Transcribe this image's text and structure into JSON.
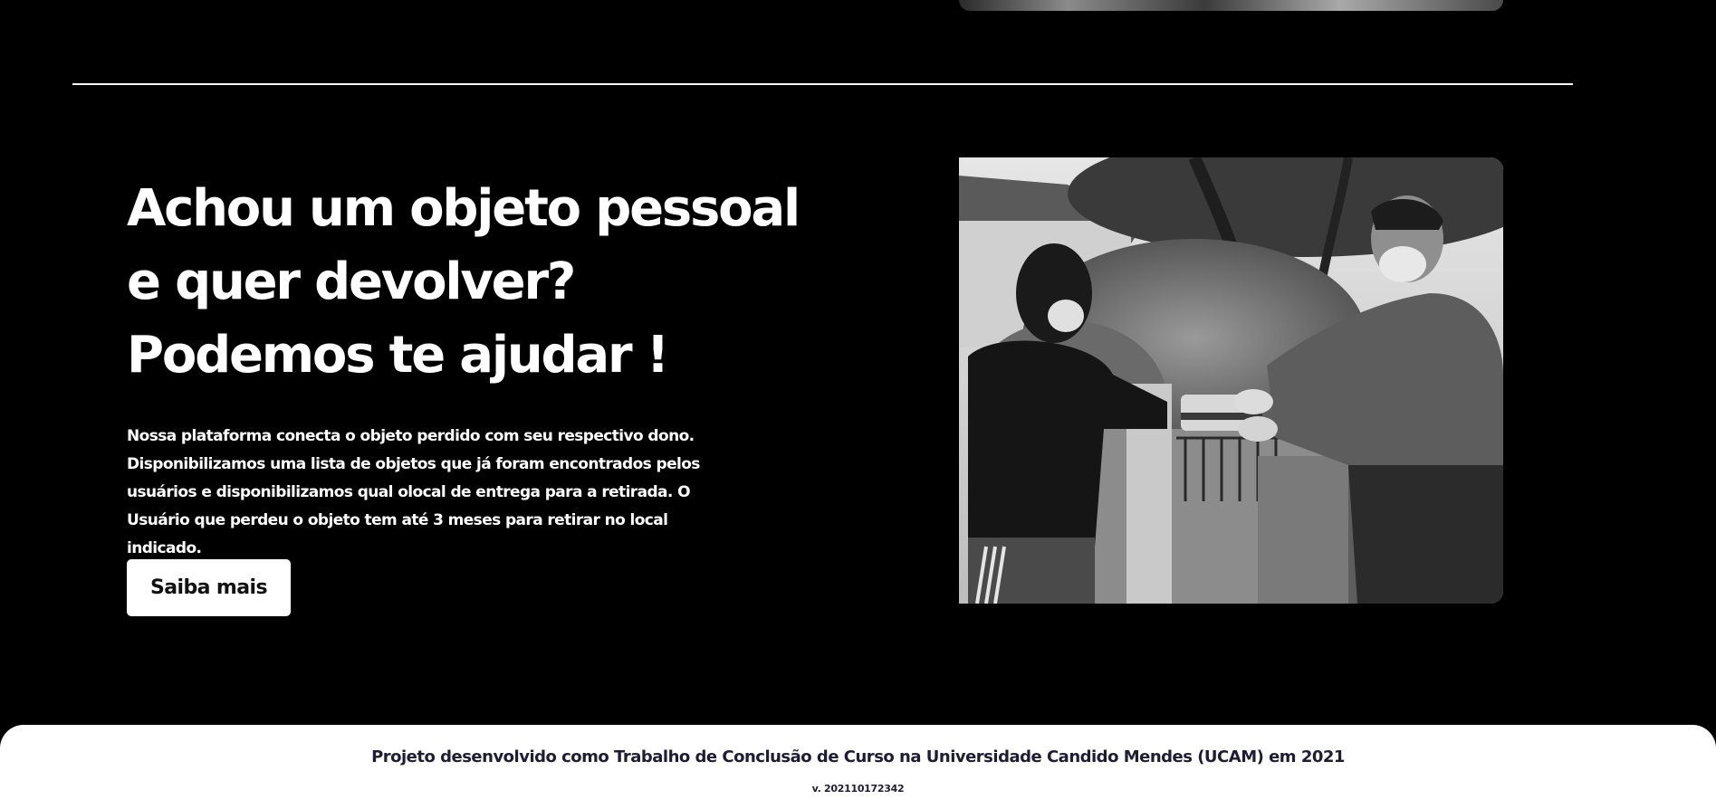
{
  "hero": {
    "title_lines": [
      "Achou um objeto pessoal",
      "e quer devolver?",
      "Podemos te ajudar !"
    ],
    "description": "Nossa plataforma conecta o objeto perdido com seu respectivo dono. Disponibilizamos uma lista de objetos que já foram encontrados pelos usuários e disponibilizamos qual olocal de entrega para a retirada. O Usuário que perdeu o objeto tem até 3 meses para retirar no local indicado.",
    "cta_label": "Saiba mais"
  },
  "footer": {
    "text": "Projeto desenvolvido como Trabalho de Conclusão de Curso na Universidade Candido Mendes (UCAM) em 2021",
    "version": "v. 202110172342"
  },
  "colors": {
    "background": "#000000",
    "text_light": "#ffffff",
    "footer_background": "#ffffff",
    "footer_text": "#1d1d33"
  }
}
